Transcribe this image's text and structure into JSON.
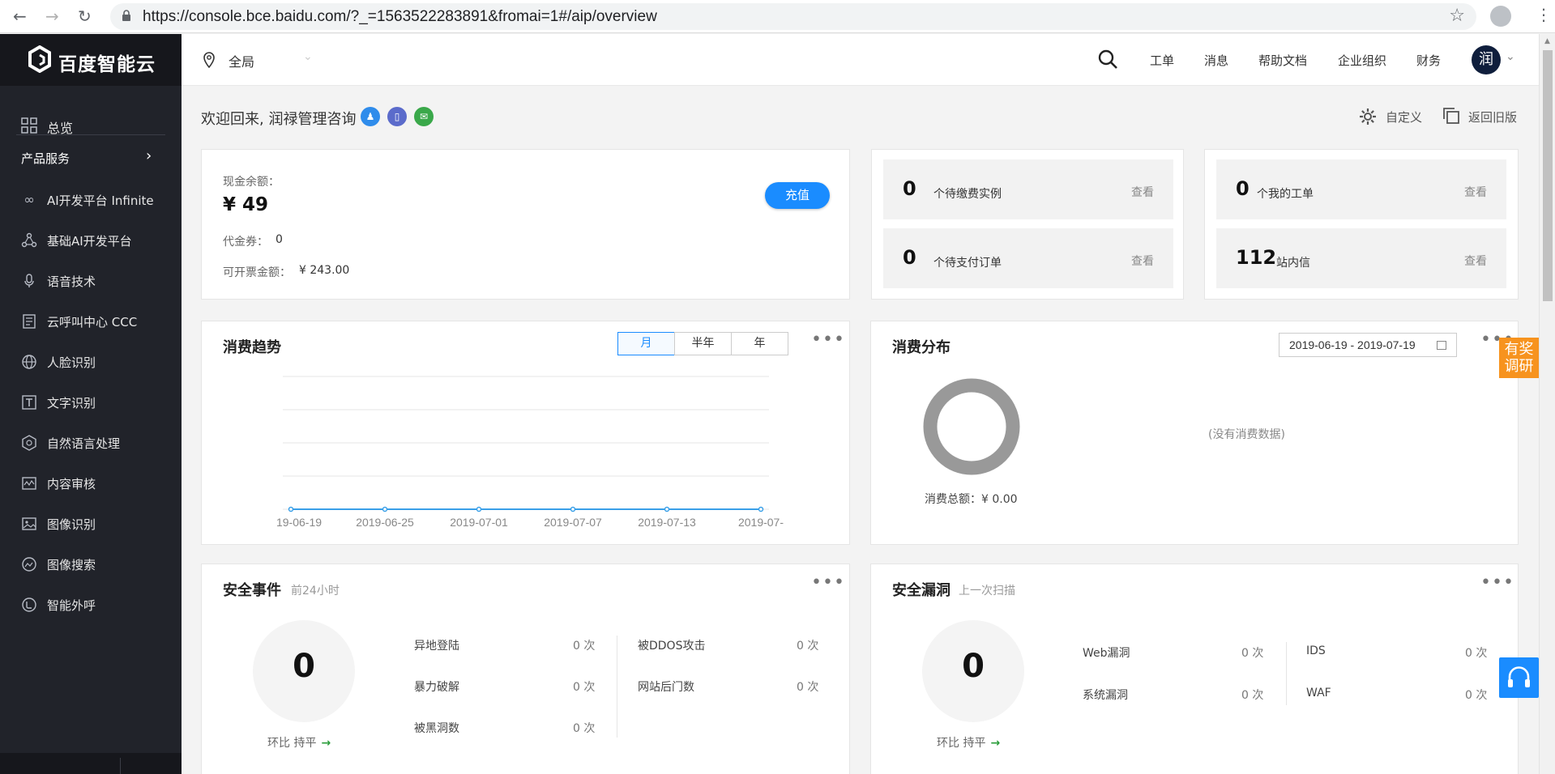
{
  "browser": {
    "url": "https://console.bce.baidu.com/?_=1563522283891&fromai=1#/aip/overview"
  },
  "sidebar": {
    "logo_text": "百度智能云",
    "overview_label": "总览",
    "products_label": "产品服务",
    "items": [
      {
        "label": "AI开发平台 Infinite",
        "icon": "infinity-icon"
      },
      {
        "label": "基础AI开发平台",
        "icon": "network-icon"
      },
      {
        "label": "语音技术",
        "icon": "microphone-icon"
      },
      {
        "label": "云呼叫中心 CCC",
        "icon": "call-center-icon"
      },
      {
        "label": "人脸识别",
        "icon": "globe-icon"
      },
      {
        "label": "文字识别",
        "icon": "text-icon"
      },
      {
        "label": "自然语言处理",
        "icon": "hexagon-icon"
      },
      {
        "label": "内容审核",
        "icon": "waveform-icon"
      },
      {
        "label": "图像识别",
        "icon": "image-icon"
      },
      {
        "label": "图像搜索",
        "icon": "image-search-icon"
      },
      {
        "label": "智能外呼",
        "icon": "outbound-call-icon"
      }
    ]
  },
  "topbar": {
    "region": "全局",
    "links": [
      "工单",
      "消息",
      "帮助文档",
      "企业组织",
      "财务"
    ],
    "avatar": "润"
  },
  "welcome": {
    "text": "欢迎回来, 润禄管理咨询",
    "customize": "自定义",
    "old_version": "返回旧版"
  },
  "account": {
    "cash_label": "现金余额：",
    "cash_value": "¥ 49",
    "voucher_label": "代金券：",
    "voucher_value": "0",
    "invoice_label": "可开票金额：",
    "invoice_value": "¥ 243.00",
    "recharge": "充值"
  },
  "stats": [
    {
      "count": "0",
      "desc": "个待缴费实例",
      "link": "查看"
    },
    {
      "count": "0",
      "desc": "个待支付订单",
      "link": "查看"
    },
    {
      "count": "0",
      "desc": "个我的工单",
      "link": "查看"
    },
    {
      "count": "112",
      "desc": "站内信",
      "link": "查看"
    }
  ],
  "trend": {
    "title": "消费趋势",
    "tabs": [
      "月",
      "半年",
      "年"
    ],
    "more": "•••"
  },
  "distribution": {
    "title": "消费分布",
    "date_range": "2019-06-19 - 2019-07-19",
    "total": "消费总额：¥ 0.00",
    "empty": "(没有消费数据)",
    "more": "•••"
  },
  "survey": {
    "line1": "有奖",
    "line2": "调研"
  },
  "security_events": {
    "title": "安全事件",
    "subtitle": "前24小时",
    "count": "0",
    "ratio": "环比 持平",
    "rows_left": [
      {
        "label": "异地登陆",
        "value": "0 次"
      },
      {
        "label": "暴力破解",
        "value": "0 次"
      },
      {
        "label": "被黑洞数",
        "value": "0 次"
      }
    ],
    "rows_right": [
      {
        "label": "被DDOS攻击",
        "value": "0 次"
      },
      {
        "label": "网站后门数",
        "value": "0 次"
      }
    ]
  },
  "security_vulns": {
    "title": "安全漏洞",
    "subtitle": "上一次扫描",
    "count": "0",
    "ratio": "环比 持平",
    "rows_left": [
      {
        "label": "Web漏洞",
        "value": "0 次"
      },
      {
        "label": "系统漏洞",
        "value": "0 次"
      }
    ],
    "rows_right": [
      {
        "label": "IDS",
        "value": "0 次"
      },
      {
        "label": "WAF",
        "value": "0 次"
      }
    ]
  },
  "chart_data": {
    "type": "line",
    "x": [
      "19-06-19",
      "2019-06-25",
      "2019-07-01",
      "2019-07-07",
      "2019-07-13",
      "2019-07-"
    ],
    "series": [
      {
        "values": [
          0,
          0,
          0,
          0,
          0,
          0
        ]
      }
    ],
    "grid": true,
    "color": "#3aa0e8"
  }
}
